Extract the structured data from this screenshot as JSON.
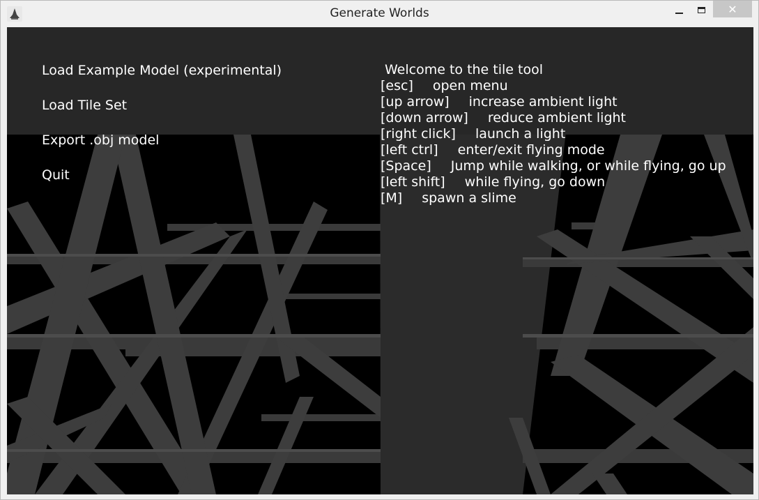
{
  "window": {
    "title": "Generate Worlds",
    "icon": "app-icon",
    "controls": {
      "minimize_icon": "minimize-icon",
      "maximize_icon": "maximize-icon",
      "close_glyph": "✕"
    }
  },
  "menu": {
    "items": [
      {
        "label": "Load Example Model (experimental)"
      },
      {
        "label": "Load Tile Set"
      },
      {
        "label": "Export .obj model"
      },
      {
        "label": "Quit"
      }
    ]
  },
  "help": {
    "welcome": "Welcome to the tile tool",
    "controls": [
      {
        "key": "[esc]",
        "action": "open menu"
      },
      {
        "key": "[up arrow]",
        "action": "increase ambient light"
      },
      {
        "key": "[down arrow]",
        "action": "reduce ambient light"
      },
      {
        "key": "[right click]",
        "action": "launch a light"
      },
      {
        "key": "[left ctrl]",
        "action": "enter/exit flying mode"
      },
      {
        "key": "[Space]",
        "action": "Jump while walking, or while flying, go up"
      },
      {
        "key": "[left shift]",
        "action": "while flying, go down"
      },
      {
        "key": "[M]",
        "action": "spawn a slime"
      }
    ]
  },
  "colors": {
    "viewport_bg": "#000000",
    "overlay_bg": "#272727",
    "beam": "#3a3a3a",
    "beam_light": "#4a4a4a",
    "text": "#ffffff",
    "titlebar": "#f0f0f0",
    "close_button": "#c7c7c7"
  }
}
